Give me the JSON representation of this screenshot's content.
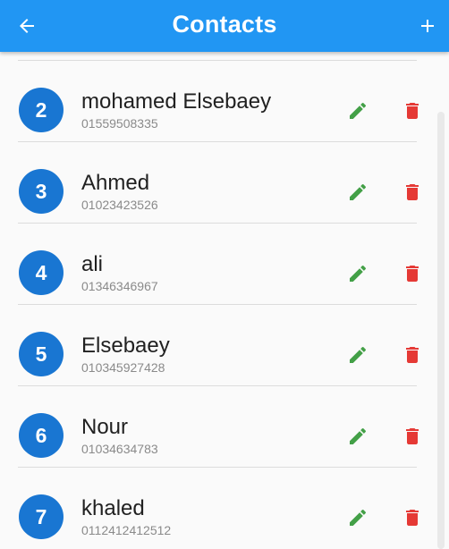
{
  "appbar": {
    "title": "Contacts",
    "back_icon": "arrow-back-icon",
    "add_icon": "plus-icon",
    "color": "#2196f3"
  },
  "contacts": [
    {
      "number": "2",
      "name": "mohamed Elsebaey",
      "phone": "01559508335"
    },
    {
      "number": "3",
      "name": "Ahmed",
      "phone": "01023423526"
    },
    {
      "number": "4",
      "name": "ali",
      "phone": "01346346967"
    },
    {
      "number": "5",
      "name": "Elsebaey",
      "phone": "010345927428"
    },
    {
      "number": "6",
      "name": "Nour",
      "phone": "01034634783"
    },
    {
      "number": "7",
      "name": "khaled",
      "phone": "0112412412512"
    }
  ],
  "icons": {
    "edit": "pencil-icon",
    "delete": "trash-icon"
  },
  "colors": {
    "avatar": "#1976d2",
    "edit": "#43a047",
    "delete": "#e53935"
  }
}
